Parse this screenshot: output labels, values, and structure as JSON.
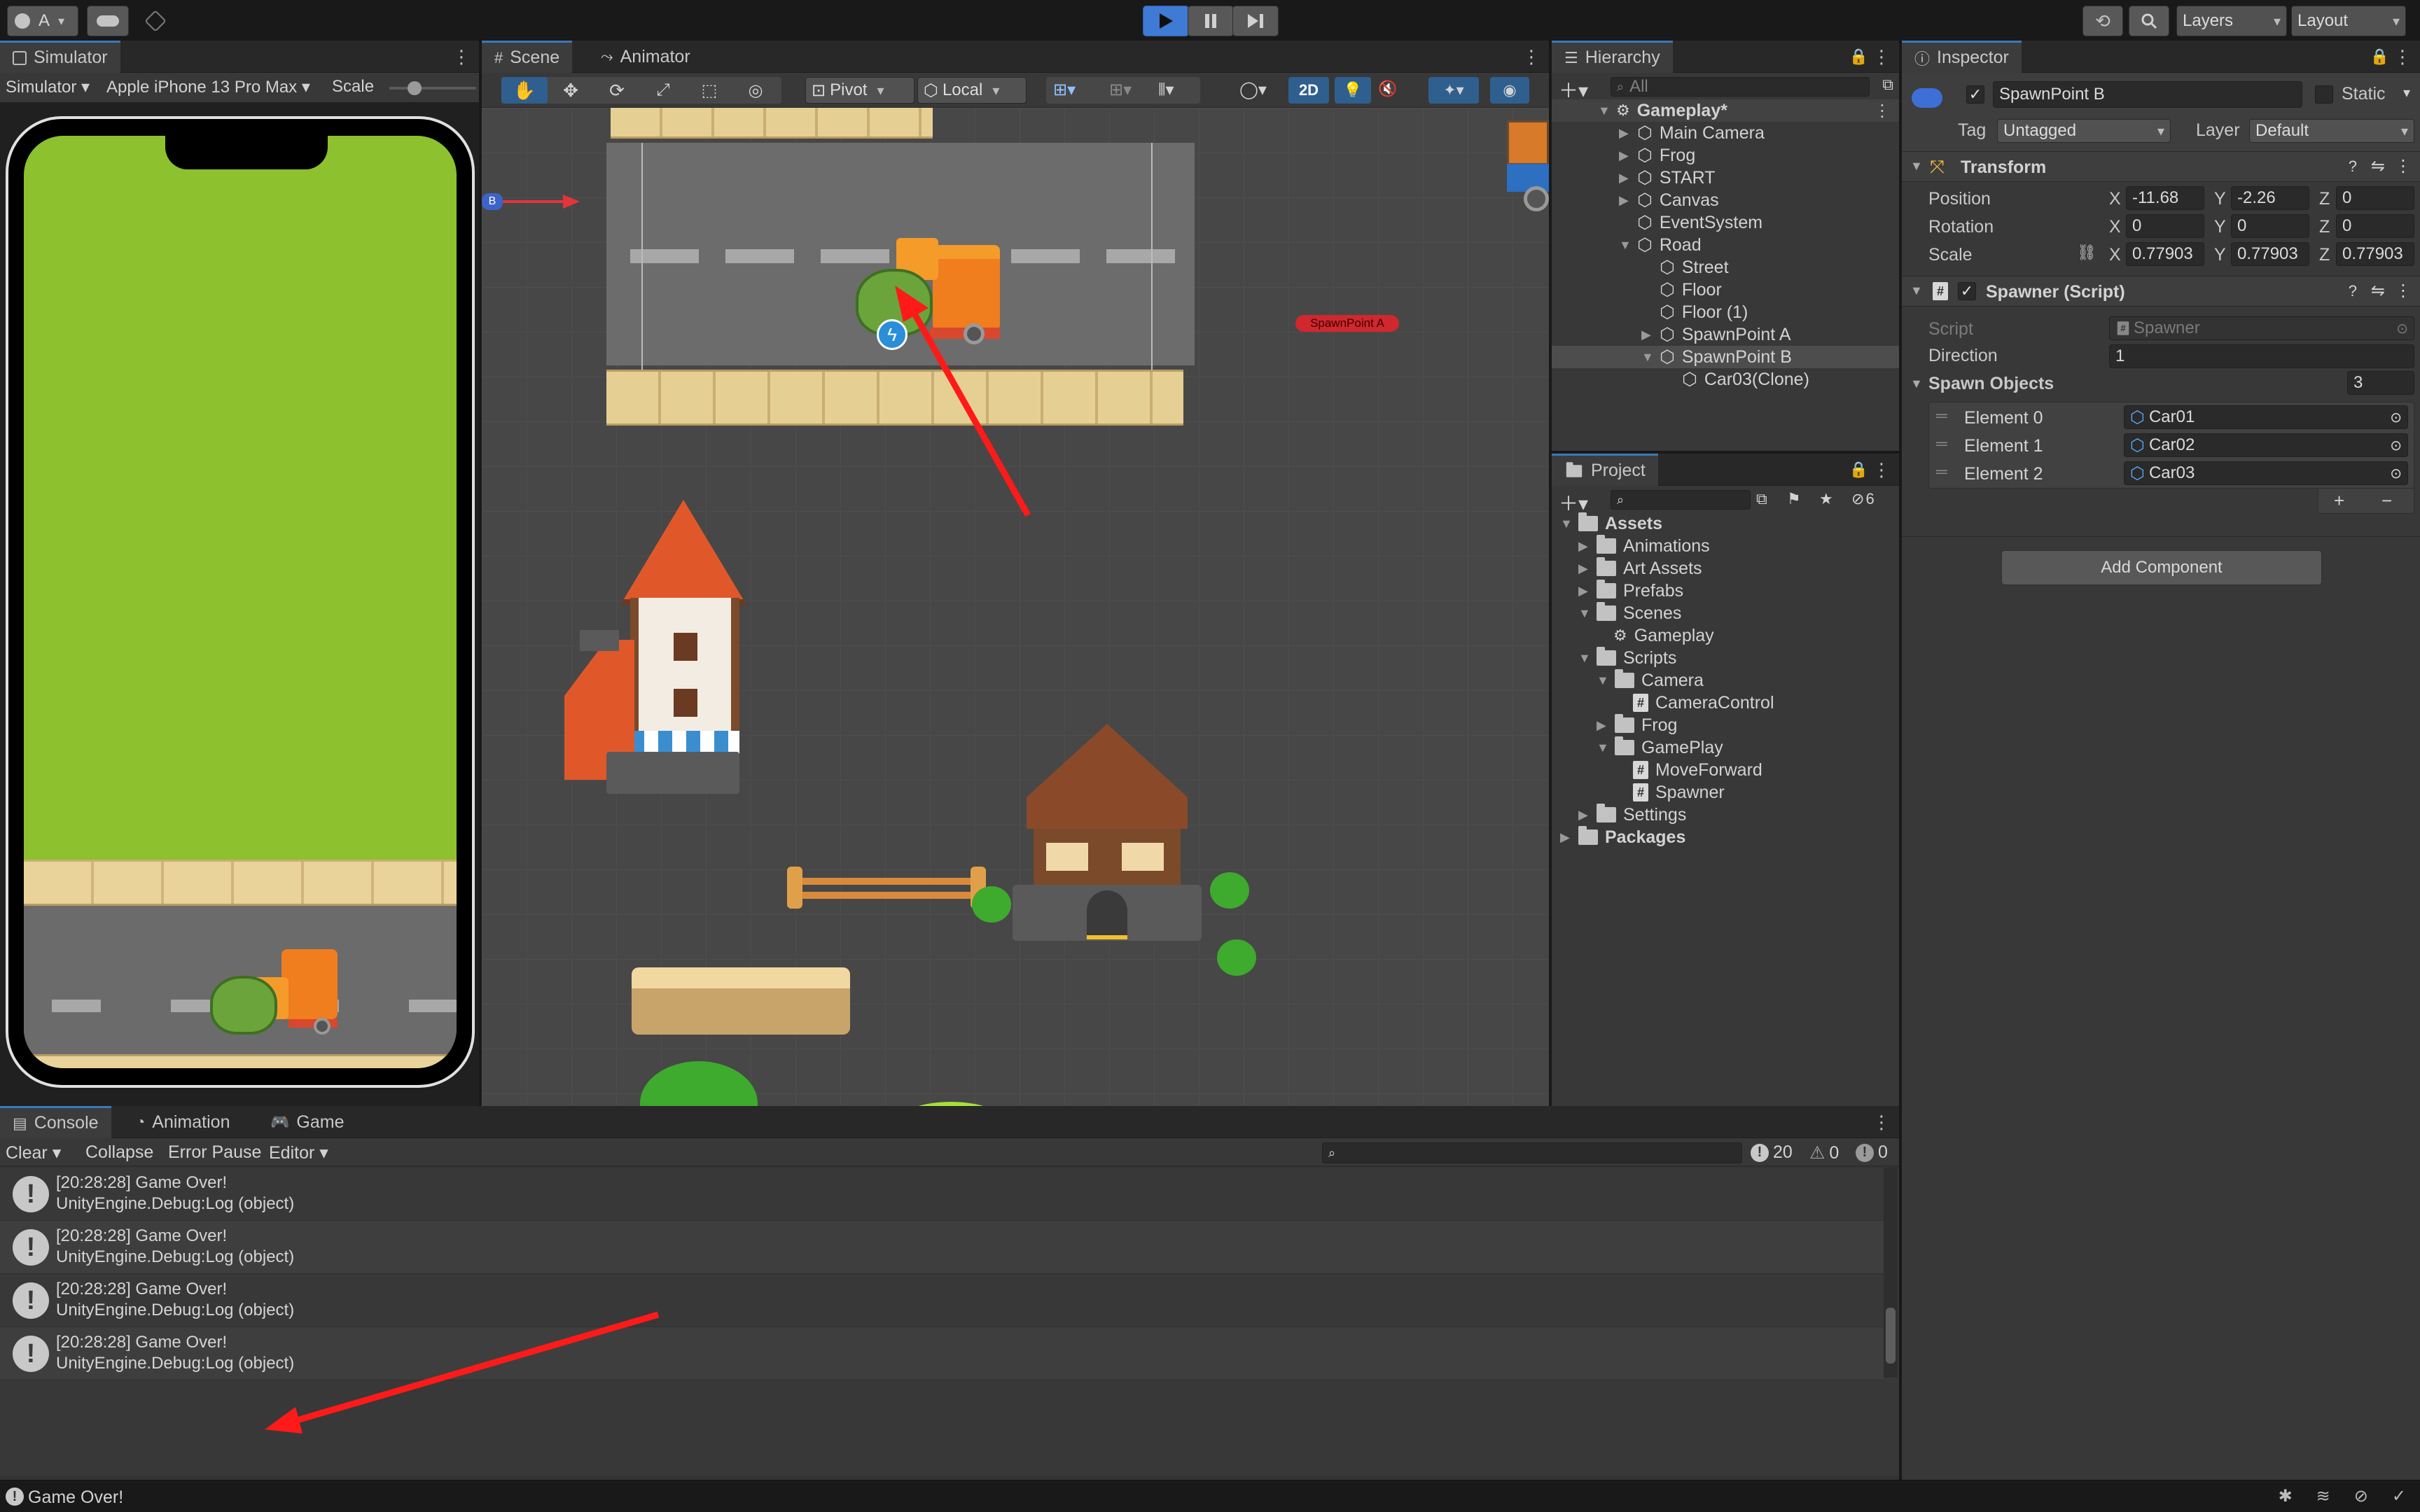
{
  "toolbar": {
    "account": "A",
    "layers": "Layers",
    "layout": "Layout"
  },
  "simulator": {
    "tab": "Simulator",
    "mode": "Simulator",
    "device": "Apple iPhone 13 Pro Max",
    "scale_label": "Scale"
  },
  "scene": {
    "tab_scene": "Scene",
    "tab_animator": "Animator",
    "pivot": "Pivot",
    "local": "Local",
    "mode_2d": "2D",
    "spawnpoint_a_label": "SpawnPoint A",
    "spawnpoint_b_label": "B"
  },
  "hierarchy": {
    "tab": "Hierarchy",
    "search_placeholder": "All",
    "items": [
      {
        "label": "Gameplay*"
      },
      {
        "label": "Main Camera"
      },
      {
        "label": "Frog"
      },
      {
        "label": "START"
      },
      {
        "label": "Canvas"
      },
      {
        "label": "EventSystem"
      },
      {
        "label": "Road"
      },
      {
        "label": "Street"
      },
      {
        "label": "Floor"
      },
      {
        "label": "Floor (1)"
      },
      {
        "label": "SpawnPoint A"
      },
      {
        "label": "SpawnPoint B"
      },
      {
        "label": "Car03(Clone)"
      }
    ]
  },
  "project": {
    "tab": "Project",
    "badge": "6",
    "items": [
      {
        "label": "Assets"
      },
      {
        "label": "Animations"
      },
      {
        "label": "Art Assets"
      },
      {
        "label": "Prefabs"
      },
      {
        "label": "Scenes"
      },
      {
        "label": "Gameplay"
      },
      {
        "label": "Scripts"
      },
      {
        "label": "Camera"
      },
      {
        "label": "CameraControl"
      },
      {
        "label": "Frog"
      },
      {
        "label": "GamePlay"
      },
      {
        "label": "MoveForward"
      },
      {
        "label": "Spawner"
      },
      {
        "label": "Settings"
      },
      {
        "label": "Packages"
      }
    ]
  },
  "inspector": {
    "tab": "Inspector",
    "object_name": "SpawnPoint B",
    "static_label": "Static",
    "tag_label": "Tag",
    "tag_value": "Untagged",
    "layer_label": "Layer",
    "layer_value": "Default",
    "transform": {
      "title": "Transform",
      "position_label": "Position",
      "rotation_label": "Rotation",
      "scale_label": "Scale",
      "x": "X",
      "y": "Y",
      "z": "Z",
      "pos_x": "-11.68",
      "pos_y": "-2.26",
      "pos_z": "0",
      "rot_x": "0",
      "rot_y": "0",
      "rot_z": "0",
      "scale_x": "0.77903",
      "scale_y": "0.77903",
      "scale_z": "0.77903"
    },
    "spawner": {
      "title": "Spawner (Script)",
      "script_label": "Script",
      "script_value": "Spawner",
      "direction_label": "Direction",
      "direction_value": "1",
      "spawn_objects_label": "Spawn Objects",
      "spawn_objects_count": "3",
      "elements": [
        {
          "label": "Element 0",
          "value": "Car01"
        },
        {
          "label": "Element 1",
          "value": "Car02"
        },
        {
          "label": "Element 2",
          "value": "Car03"
        }
      ],
      "plus": "+",
      "minus": "−"
    },
    "add_component": "Add Component"
  },
  "console": {
    "tab_console": "Console",
    "tab_animation": "Animation",
    "tab_game": "Game",
    "clear": "Clear",
    "collapse": "Collapse",
    "error_pause": "Error Pause",
    "editor": "Editor",
    "count_info": "20",
    "count_warn": "0",
    "count_error": "0",
    "entries": [
      {
        "line1": "[20:28:28] Game Over!",
        "line2": "UnityEngine.Debug:Log (object)"
      },
      {
        "line1": "[20:28:28] Game Over!",
        "line2": "UnityEngine.Debug:Log (object)"
      },
      {
        "line1": "[20:28:28] Game Over!",
        "line2": "UnityEngine.Debug:Log (object)"
      },
      {
        "line1": "[20:28:28] Game Over!",
        "line2": "UnityEngine.Debug:Log (object)"
      }
    ]
  },
  "status": {
    "message": "Game Over!"
  },
  "colors": {
    "accent": "#3a79bb",
    "play_active": "#3f7ad4",
    "annotation_arrow": "#ff1a1a",
    "grass": "#8dc12d"
  }
}
